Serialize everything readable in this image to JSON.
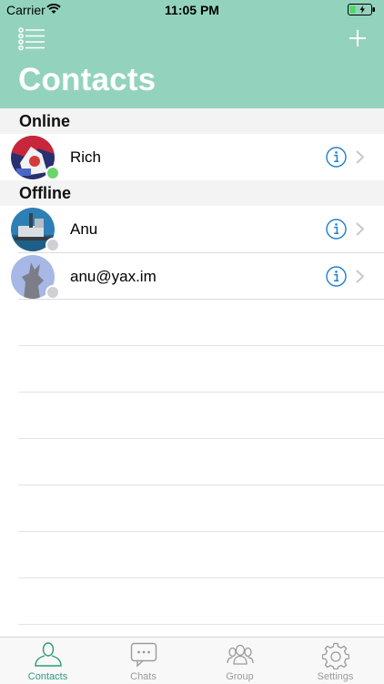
{
  "status_bar": {
    "carrier": "Carrier",
    "time": "11:05 PM",
    "wifi_icon": "wifi-icon",
    "battery_icon": "battery-icon"
  },
  "header": {
    "title": "Contacts",
    "left_icon": "list-icon",
    "right_icon": "plus-icon",
    "background": "#93d3bd"
  },
  "sections": {
    "online": {
      "title": "Online"
    },
    "offline": {
      "title": "Offline"
    }
  },
  "contacts": [
    {
      "name": "Rich",
      "status": "online",
      "status_color": "#6bd46b",
      "avatar_icon": "contact-avatar"
    },
    {
      "name": "Anu",
      "status": "offline",
      "status_color": "#cfcfd4",
      "avatar_icon": "contact-avatar"
    },
    {
      "name": "anu@yax.im",
      "status": "offline",
      "status_color": "#cfcfd4",
      "avatar_icon": "default-avatar"
    }
  ],
  "tabs": [
    {
      "label": "Contacts",
      "icon": "person-icon",
      "active": true
    },
    {
      "label": "Chats",
      "icon": "chat-bubble-icon",
      "active": false
    },
    {
      "label": "Group",
      "icon": "group-icon",
      "active": false
    },
    {
      "label": "Settings",
      "icon": "gear-icon",
      "active": false
    }
  ],
  "colors": {
    "accent": "#2f9a7a",
    "info": "#1b7fd1",
    "inactive_tab": "#9b9b9b"
  }
}
